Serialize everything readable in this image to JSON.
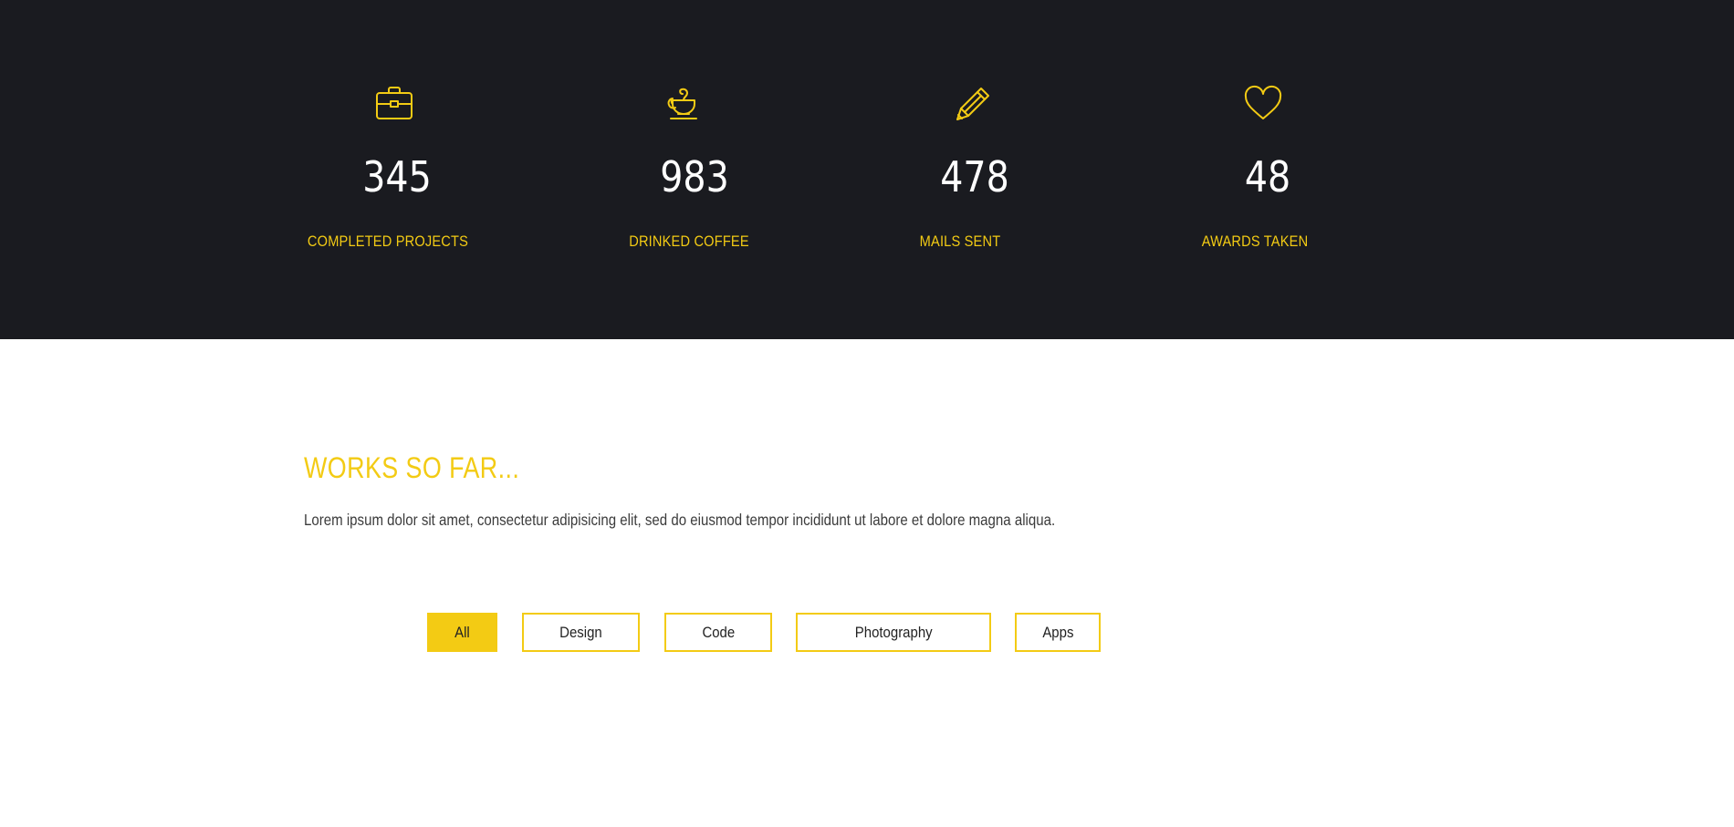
{
  "colors": {
    "accent": "#f3cb14",
    "dark_background": "#1a1b20",
    "light_background": "#ffffff"
  },
  "stats": [
    {
      "icon": "briefcase-icon",
      "number": "345",
      "label": "COMPLETED PROJECTS"
    },
    {
      "icon": "coffee-cup-icon",
      "number": "983",
      "label": "DRINKED COFFEE"
    },
    {
      "icon": "pencil-icon",
      "number": "478",
      "label": "MAILS SENT"
    },
    {
      "icon": "heart-icon",
      "number": "48",
      "label": "AWARDS TAKEN"
    }
  ],
  "works": {
    "title": "WORKS SO FAR...",
    "description": "Lorem ipsum dolor sit amet, consectetur adipisicing elit, sed do eiusmod tempor incididunt ut labore et dolore magna aliqua.",
    "filters": [
      "All",
      "Design",
      "Code",
      "Photography",
      "Apps"
    ],
    "active_filter": "All"
  }
}
